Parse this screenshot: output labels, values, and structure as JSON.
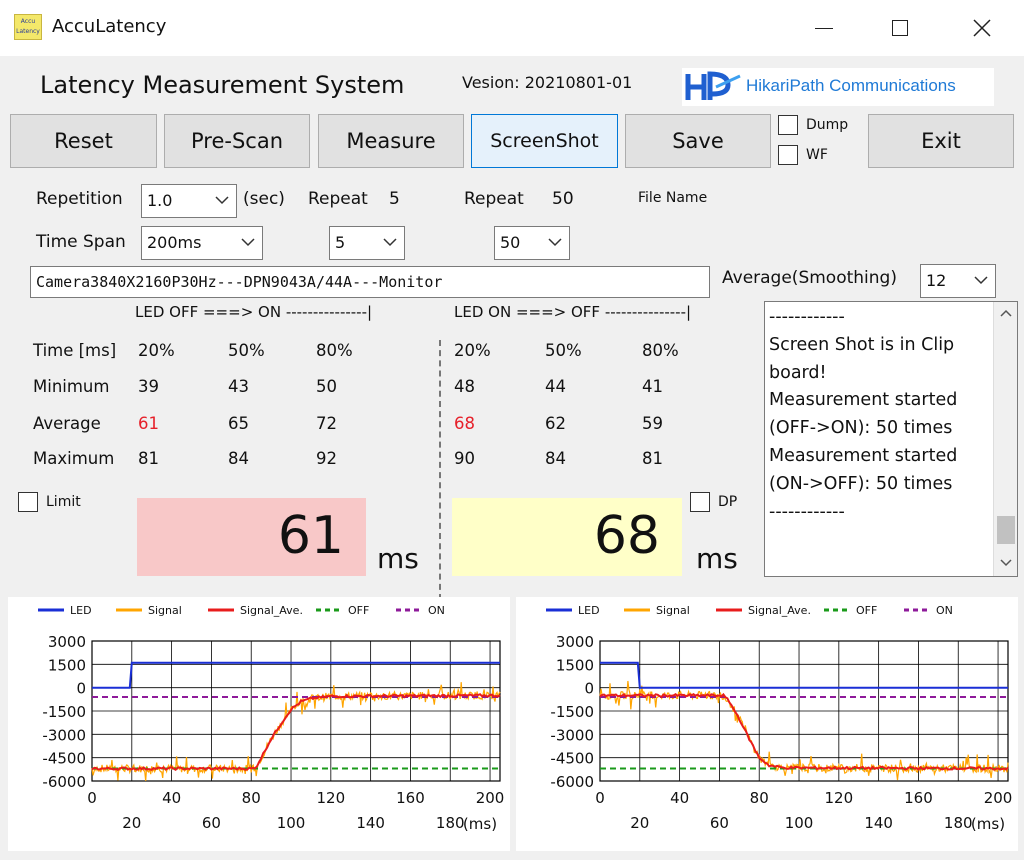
{
  "window": {
    "title": "AccuLatency",
    "icon_text_top": "Accu",
    "icon_text_bottom": "Latency"
  },
  "header": {
    "system_title": "Latency Measurement System",
    "version": "Vesion: 20210801-01",
    "logo_text": "HikariPath Communications"
  },
  "toolbar": {
    "reset": "Reset",
    "prescan": "Pre-Scan",
    "measure": "Measure",
    "screenshot": "ScreenShot",
    "save": "Save",
    "exit": "Exit",
    "dump_label": "Dump",
    "wf_label": "WF"
  },
  "settings": {
    "repetition_label": "Repetition",
    "repetition_value": "1.0",
    "repetition_unit": "(sec)",
    "timespan_label": "Time Span",
    "timespan_value": "200ms",
    "repeat_label_1": "Repeat",
    "repeat_value_1": "5",
    "repeat_select_1": "5",
    "repeat_label_2": "Repeat",
    "repeat_value_2": "50",
    "repeat_select_2": "50",
    "file_name_label": "File Name",
    "file_name_value": "Camera3840X2160P30Hz---DPN9043A/44A---Monitor",
    "average_label": "Average(Smoothing)",
    "average_value": "12"
  },
  "results": {
    "off_on_header": "LED OFF ===> ON ---------------|",
    "on_off_header": "LED ON ===> OFF ---------------|",
    "row_labels": [
      "Time [ms]",
      "Minimum",
      "Average",
      "Maximum"
    ],
    "off_on": {
      "cols": [
        "20%",
        "50%",
        "80%"
      ],
      "minimum": [
        "39",
        "43",
        "50"
      ],
      "average": [
        "61",
        "65",
        "72"
      ],
      "maximum": [
        "81",
        "84",
        "92"
      ]
    },
    "on_off": {
      "cols": [
        "20%",
        "50%",
        "80%"
      ],
      "minimum": [
        "48",
        "44",
        "41"
      ],
      "average": [
        "68",
        "62",
        "59"
      ],
      "maximum": [
        "90",
        "84",
        "81"
      ]
    },
    "limit_label": "Limit",
    "dp_label": "DP",
    "off_on_big": "61",
    "on_off_big": "68",
    "unit": "ms"
  },
  "log": {
    "lines": [
      "------------",
      "Screen Shot is in Clip",
      "board!",
      "Measurement started",
      "(OFF->ON): 50 times",
      "Measurement started",
      "(ON->OFF): 50 times",
      "------------"
    ]
  },
  "colors": {
    "led": "#1a2fd6",
    "signal": "#ffa500",
    "signal_ave": "#e81c1c",
    "off": "#1a9a1a",
    "on": "#8e1a9a",
    "accent": "#0078d7"
  },
  "chart_data": [
    {
      "type": "line",
      "legend": [
        "LED",
        "Signal",
        "Signal_Ave.",
        "OFF",
        "ON"
      ],
      "xlabel": "(ms)",
      "x_ticks_top": [
        "0",
        "40",
        "80",
        "120",
        "160",
        "200"
      ],
      "x_ticks_bottom": [
        "20",
        "60",
        "100",
        "140",
        "180"
      ],
      "y_ticks": [
        "3000",
        "1500",
        "0",
        "-1500",
        "-3000",
        "-4500",
        "-6000"
      ],
      "xlim": [
        0,
        205
      ],
      "ylim": [
        -6000,
        3000
      ],
      "series": [
        {
          "name": "LED",
          "points": [
            [
              0,
              0
            ],
            [
              19,
              0
            ],
            [
              20,
              1600
            ],
            [
              205,
              1600
            ]
          ]
        },
        {
          "name": "Signal_Ave.",
          "points": [
            [
              0,
              -5200
            ],
            [
              82,
              -5200
            ],
            [
              85,
              -4500
            ],
            [
              90,
              -3300
            ],
            [
              95,
              -2300
            ],
            [
              100,
              -1400
            ],
            [
              105,
              -900
            ],
            [
              110,
              -700
            ],
            [
              120,
              -550
            ],
            [
              205,
              -500
            ]
          ]
        },
        {
          "name": "OFF",
          "points": [
            [
              0,
              -5200
            ],
            [
              205,
              -5200
            ]
          ]
        },
        {
          "name": "ON",
          "points": [
            [
              0,
              -600
            ],
            [
              205,
              -600
            ]
          ]
        }
      ]
    },
    {
      "type": "line",
      "legend": [
        "LED",
        "Signal",
        "Signal_Ave.",
        "OFF",
        "ON"
      ],
      "xlabel": "(ms)",
      "x_ticks_top": [
        "0",
        "40",
        "80",
        "120",
        "160",
        "200"
      ],
      "x_ticks_bottom": [
        "20",
        "60",
        "100",
        "140",
        "180"
      ],
      "y_ticks": [
        "3000",
        "1500",
        "0",
        "-1500",
        "-3000",
        "-4500",
        "-6000"
      ],
      "xlim": [
        0,
        205
      ],
      "ylim": [
        -6000,
        3000
      ],
      "series": [
        {
          "name": "LED",
          "points": [
            [
              0,
              1600
            ],
            [
              19,
              1600
            ],
            [
              20,
              0
            ],
            [
              205,
              0
            ]
          ]
        },
        {
          "name": "Signal_Ave.",
          "points": [
            [
              0,
              -500
            ],
            [
              62,
              -500
            ],
            [
              65,
              -900
            ],
            [
              70,
              -2000
            ],
            [
              75,
              -3300
            ],
            [
              80,
              -4500
            ],
            [
              85,
              -5000
            ],
            [
              92,
              -5150
            ],
            [
              205,
              -5200
            ]
          ]
        },
        {
          "name": "OFF",
          "points": [
            [
              0,
              -5200
            ],
            [
              205,
              -5200
            ]
          ]
        },
        {
          "name": "ON",
          "points": [
            [
              0,
              -600
            ],
            [
              205,
              -600
            ]
          ]
        }
      ]
    }
  ]
}
